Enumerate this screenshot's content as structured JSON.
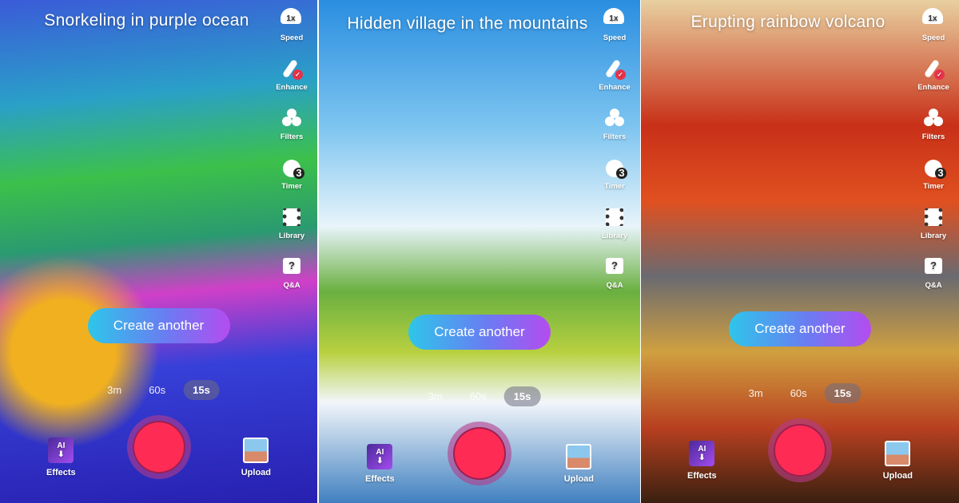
{
  "panels": [
    {
      "title": "Snorkeling in purple ocean"
    },
    {
      "title": "Hidden village in the mountains"
    },
    {
      "title": "Erupting rainbow volcano"
    }
  ],
  "side_items": [
    {
      "label": "Speed",
      "icon": "speed-gauge-icon",
      "badge": "1x"
    },
    {
      "label": "Enhance",
      "icon": "magic-wand-icon"
    },
    {
      "label": "Filters",
      "icon": "filters-icon"
    },
    {
      "label": "Timer",
      "icon": "timer-icon",
      "badge": "3"
    },
    {
      "label": "Library",
      "icon": "film-library-icon"
    },
    {
      "label": "Q&A",
      "icon": "question-bubble-icon",
      "badge": "?"
    }
  ],
  "create_label": "Create another",
  "durations": [
    {
      "label": "3m"
    },
    {
      "label": "60s"
    },
    {
      "label": "15s",
      "selected": true
    }
  ],
  "effects": {
    "label": "Effects",
    "badge": "AI"
  },
  "upload": {
    "label": "Upload"
  },
  "colors": {
    "record": "#fe2c55",
    "accent_start": "#2ec6ea",
    "accent_end": "#b44cf0"
  }
}
